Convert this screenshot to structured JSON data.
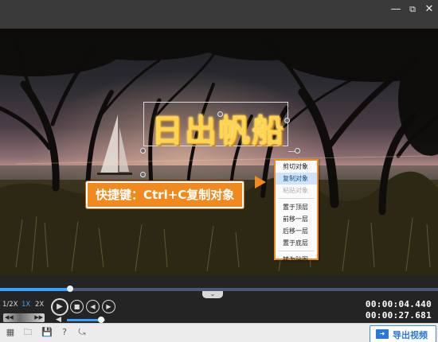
{
  "window": {
    "icons": {
      "minimize": "minimize-icon",
      "restore": "restore-icon",
      "close": "close-icon"
    }
  },
  "preview": {
    "title_text": "日出帆船",
    "callout": "快捷键：Ctrl+C复制对象"
  },
  "context_menu": {
    "items": [
      {
        "label": "剪切对象",
        "state": "normal"
      },
      {
        "label": "复制对象",
        "state": "active"
      },
      {
        "label": "粘贴对象",
        "state": "disabled"
      },
      {
        "label": "置于顶层",
        "state": "normal"
      },
      {
        "label": "前移一层",
        "state": "normal"
      },
      {
        "label": "后移一层",
        "state": "normal"
      },
      {
        "label": "置于底层",
        "state": "normal"
      },
      {
        "label": "转为贴图",
        "state": "normal"
      }
    ]
  },
  "player": {
    "progress_percent": 16,
    "volume_percent": 90,
    "speeds": [
      "1/2X",
      "1X",
      "2X"
    ],
    "selected_speed": "1X",
    "speed_bar": {
      "left": "◀◀",
      "right": "▶▶"
    },
    "buttons": {
      "play": "▶",
      "stop": "■",
      "prev": "◀",
      "next": "▶"
    },
    "current_time": "00:00:04.440",
    "total_time": "00:00:27.681"
  },
  "toolbar": {
    "export_label": "导出视频"
  },
  "colors": {
    "accent": "#f08a1e",
    "title_yellow": "#ffd54a",
    "progress_blue": "#3aa0ff",
    "export_blue": "#2b78d6"
  }
}
